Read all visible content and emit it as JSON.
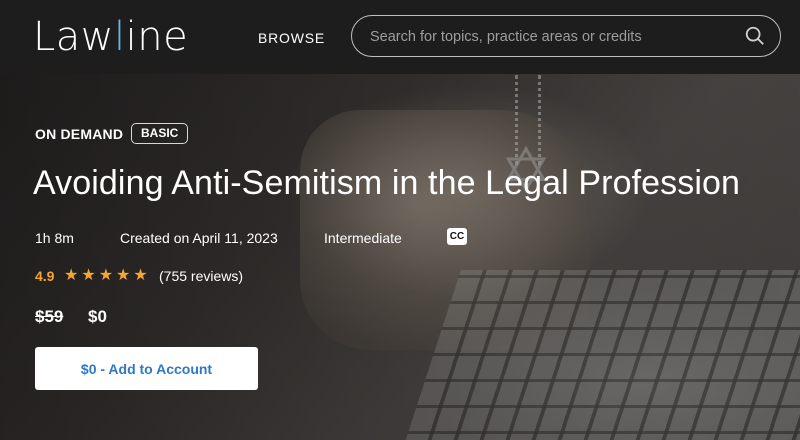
{
  "header": {
    "logo_text_start": "Law",
    "logo_text_accent": "l",
    "logo_text_end": "ine",
    "browse_label": "BROWSE",
    "search_placeholder": "Search for topics, practice areas or credits",
    "search_icon": "search-icon"
  },
  "course": {
    "kind": "ON DEMAND",
    "badge": "BASIC",
    "title": "Avoiding Anti-Semitism in the Legal Profession",
    "duration": "1h 8m",
    "created": "Created on April 11, 2023",
    "level": "Intermediate",
    "cc_label": "CC",
    "rating": "4.9",
    "stars_count": 5,
    "reviews": "(755 reviews)",
    "old_price": "$59",
    "new_price": "$0",
    "cta_label": "$0 - Add to Account"
  },
  "colors": {
    "accent": "#6fb6e6",
    "star": "#f3a536",
    "cta_text": "#2f78c4"
  }
}
